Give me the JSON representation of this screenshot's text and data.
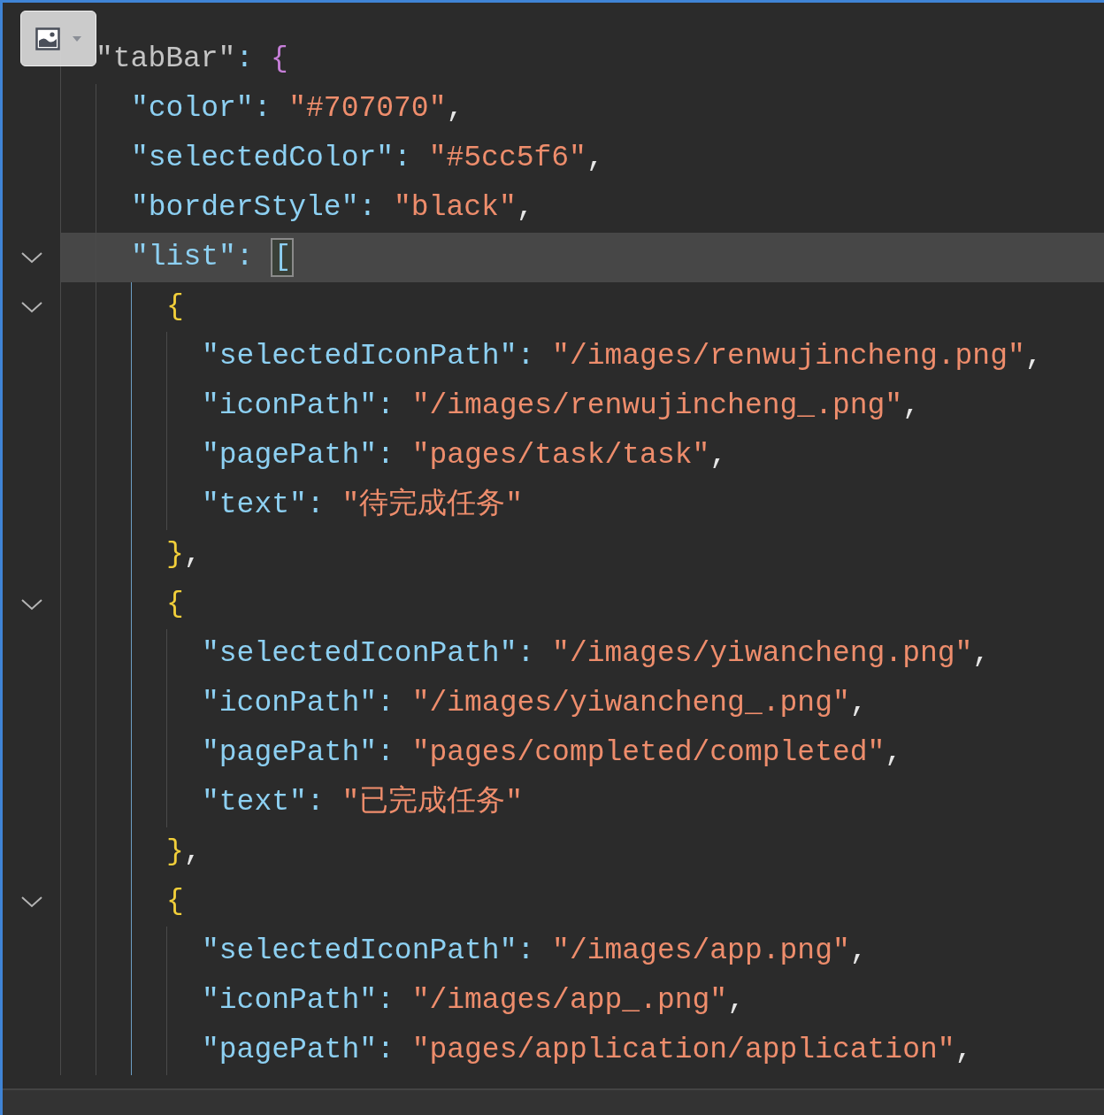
{
  "lines": [
    {
      "tokens": [
        {
          "kind": "key",
          "text": "\"tabBar\"",
          "dimmed": true
        },
        {
          "kind": "colon",
          "text": ":"
        },
        {
          "kind": "brace-outer",
          "text": "{"
        }
      ],
      "children": [
        {
          "tokens": [
            {
              "kind": "key",
              "text": "\"color\""
            },
            {
              "kind": "colon",
              "text": ":"
            },
            {
              "kind": "string",
              "text": "\"#707070\""
            },
            {
              "kind": "comma",
              "text": ","
            }
          ]
        },
        {
          "tokens": [
            {
              "kind": "key",
              "text": "\"selectedColor\""
            },
            {
              "kind": "colon",
              "text": ":"
            },
            {
              "kind": "string",
              "text": "\"#5cc5f6\""
            },
            {
              "kind": "comma",
              "text": ","
            }
          ]
        },
        {
          "tokens": [
            {
              "kind": "key",
              "text": "\"borderStyle\""
            },
            {
              "kind": "colon",
              "text": ":"
            },
            {
              "kind": "string",
              "text": "\"black\""
            },
            {
              "kind": "comma",
              "text": ","
            }
          ]
        },
        {
          "fold": true,
          "current": true,
          "tokens": [
            {
              "kind": "key",
              "text": "\"list\""
            },
            {
              "kind": "colon",
              "text": ":"
            },
            {
              "kind": "bracket",
              "text": "[",
              "matched": true
            }
          ],
          "children": [
            {
              "fold": true,
              "tokens": [
                {
                  "kind": "brace",
                  "text": "{"
                }
              ],
              "close": [
                {
                  "kind": "brace",
                  "text": "}"
                },
                {
                  "kind": "comma",
                  "text": ","
                }
              ],
              "children": [
                {
                  "tokens": [
                    {
                      "kind": "key",
                      "text": "\"selectedIconPath\""
                    },
                    {
                      "kind": "colon",
                      "text": ":"
                    },
                    {
                      "kind": "string",
                      "text": "\"/images/renwujincheng.png\""
                    },
                    {
                      "kind": "comma",
                      "text": ","
                    }
                  ]
                },
                {
                  "tokens": [
                    {
                      "kind": "key",
                      "text": "\"iconPath\""
                    },
                    {
                      "kind": "colon",
                      "text": ":"
                    },
                    {
                      "kind": "string",
                      "text": "\"/images/renwujincheng_.png\""
                    },
                    {
                      "kind": "comma",
                      "text": ","
                    }
                  ]
                },
                {
                  "tokens": [
                    {
                      "kind": "key",
                      "text": "\"pagePath\""
                    },
                    {
                      "kind": "colon",
                      "text": ":"
                    },
                    {
                      "kind": "string",
                      "text": "\"pages/task/task\""
                    },
                    {
                      "kind": "comma",
                      "text": ","
                    }
                  ]
                },
                {
                  "tokens": [
                    {
                      "kind": "key",
                      "text": "\"text\""
                    },
                    {
                      "kind": "colon",
                      "text": ":"
                    },
                    {
                      "kind": "string",
                      "text": "\"待完成任务\""
                    }
                  ]
                }
              ]
            },
            {
              "fold": true,
              "tokens": [
                {
                  "kind": "brace",
                  "text": "{"
                }
              ],
              "close": [
                {
                  "kind": "brace",
                  "text": "}"
                },
                {
                  "kind": "comma",
                  "text": ","
                }
              ],
              "children": [
                {
                  "tokens": [
                    {
                      "kind": "key",
                      "text": "\"selectedIconPath\""
                    },
                    {
                      "kind": "colon",
                      "text": ":"
                    },
                    {
                      "kind": "string",
                      "text": "\"/images/yiwancheng.png\""
                    },
                    {
                      "kind": "comma",
                      "text": ","
                    }
                  ]
                },
                {
                  "tokens": [
                    {
                      "kind": "key",
                      "text": "\"iconPath\""
                    },
                    {
                      "kind": "colon",
                      "text": ":"
                    },
                    {
                      "kind": "string",
                      "text": "\"/images/yiwancheng_.png\""
                    },
                    {
                      "kind": "comma",
                      "text": ","
                    }
                  ]
                },
                {
                  "tokens": [
                    {
                      "kind": "key",
                      "text": "\"pagePath\""
                    },
                    {
                      "kind": "colon",
                      "text": ":"
                    },
                    {
                      "kind": "string",
                      "text": "\"pages/completed/completed\""
                    },
                    {
                      "kind": "comma",
                      "text": ","
                    }
                  ]
                },
                {
                  "tokens": [
                    {
                      "kind": "key",
                      "text": "\"text\""
                    },
                    {
                      "kind": "colon",
                      "text": ":"
                    },
                    {
                      "kind": "string",
                      "text": "\"已完成任务\""
                    }
                  ]
                }
              ]
            },
            {
              "fold": true,
              "tokens": [
                {
                  "kind": "brace",
                  "text": "{"
                }
              ],
              "children": [
                {
                  "tokens": [
                    {
                      "kind": "key",
                      "text": "\"selectedIconPath\""
                    },
                    {
                      "kind": "colon",
                      "text": ":"
                    },
                    {
                      "kind": "string",
                      "text": "\"/images/app.png\""
                    },
                    {
                      "kind": "comma",
                      "text": ","
                    }
                  ]
                },
                {
                  "tokens": [
                    {
                      "kind": "key",
                      "text": "\"iconPath\""
                    },
                    {
                      "kind": "colon",
                      "text": ":"
                    },
                    {
                      "kind": "string",
                      "text": "\"/images/app_.png\""
                    },
                    {
                      "kind": "comma",
                      "text": ","
                    }
                  ]
                },
                {
                  "tokens": [
                    {
                      "kind": "key",
                      "text": "\"pagePath\""
                    },
                    {
                      "kind": "colon",
                      "text": ":"
                    },
                    {
                      "kind": "string",
                      "text": "\"pages/application/application\""
                    },
                    {
                      "kind": "comma",
                      "text": ","
                    }
                  ]
                }
              ]
            }
          ]
        }
      ]
    }
  ]
}
